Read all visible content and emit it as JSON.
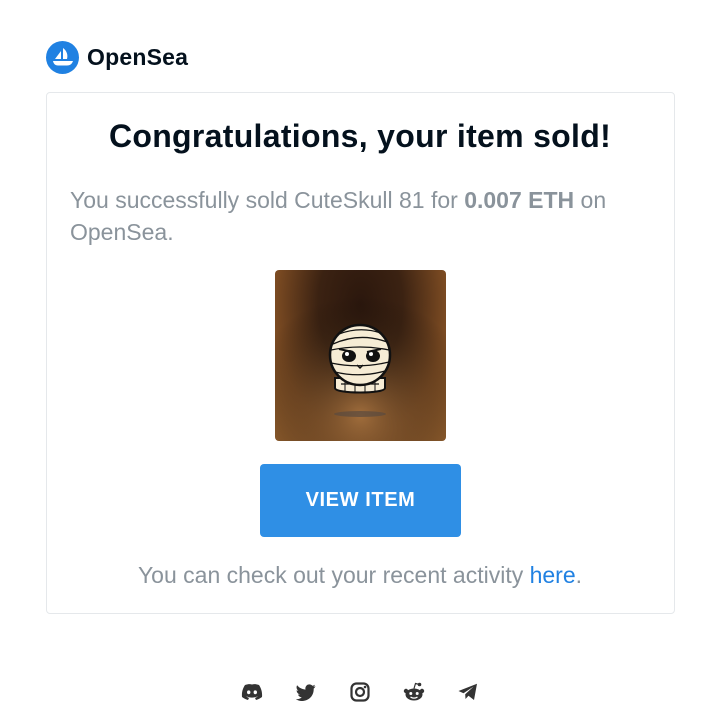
{
  "brand": {
    "name": "OpenSea"
  },
  "card": {
    "title": "Congratulations, your item sold!",
    "message_prefix": "You successfully sold CuteSkull 81 for ",
    "price": "0.007 ETH",
    "message_suffix": " on OpenSea.",
    "button_label": "VIEW ITEM",
    "activity_prefix": "You can check out your recent activity ",
    "activity_link": "here",
    "activity_suffix": "."
  },
  "footer": {
    "socials": [
      "discord-icon",
      "twitter-icon",
      "instagram-icon",
      "reddit-icon",
      "telegram-icon"
    ]
  },
  "colors": {
    "brand_blue": "#2081e2",
    "button_blue": "#2f8fe5",
    "muted_text": "#8a939b",
    "title_text": "#04111d"
  }
}
